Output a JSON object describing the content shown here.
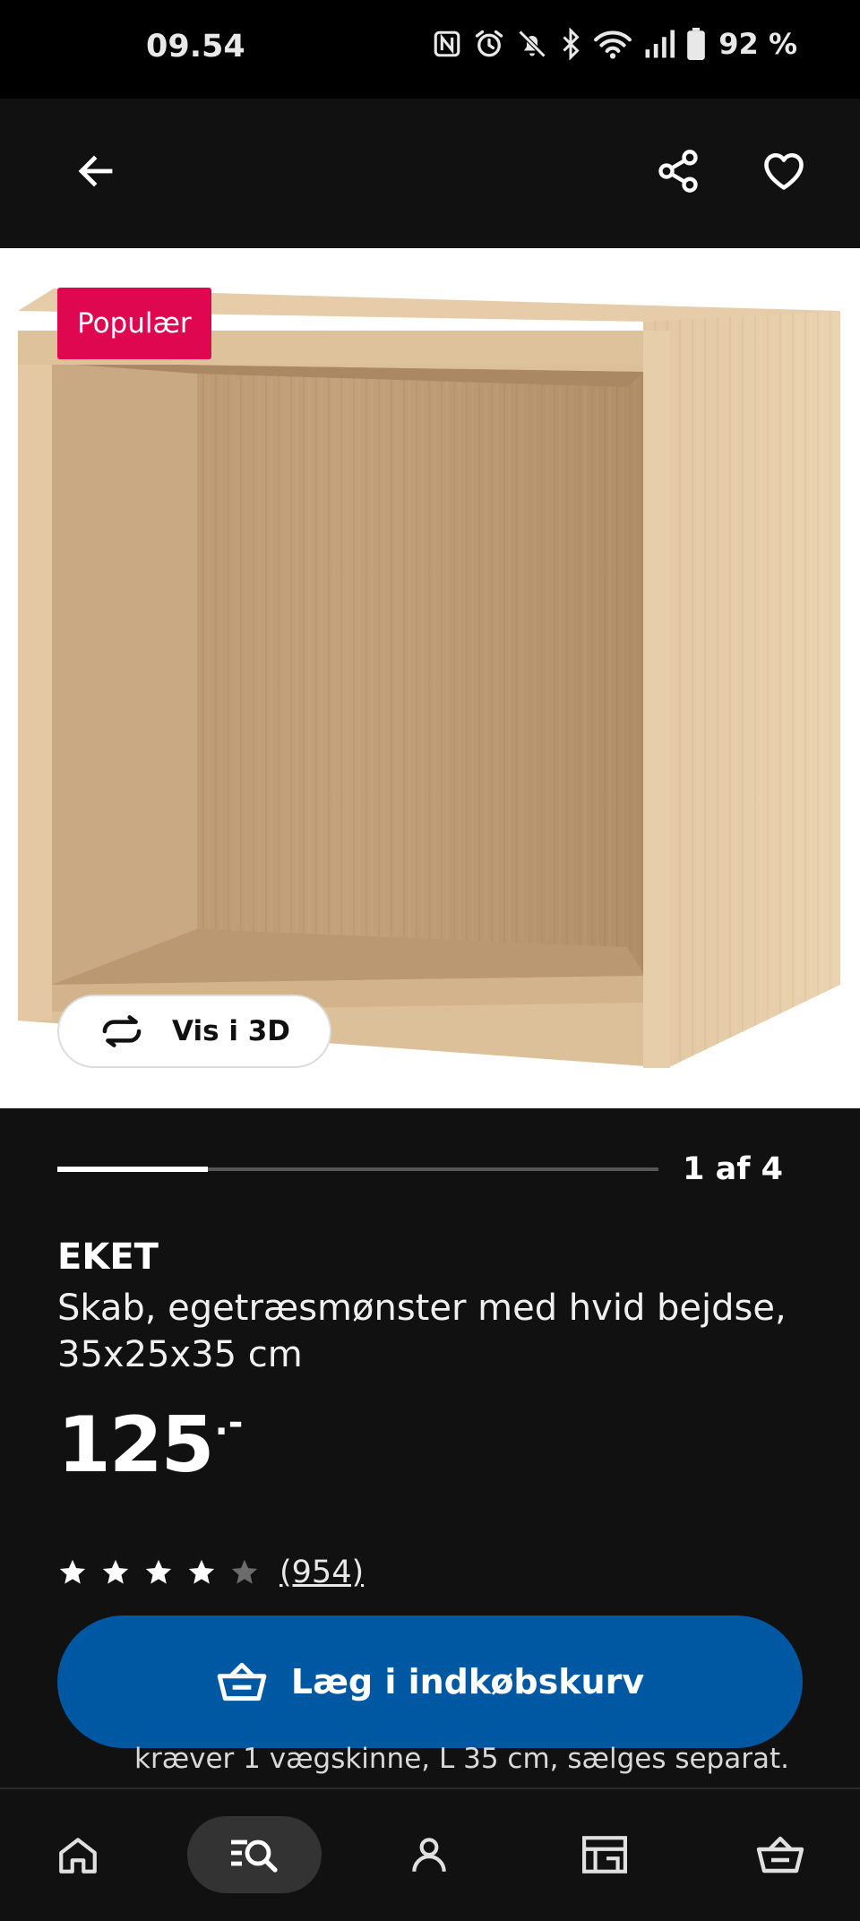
{
  "status_bar": {
    "time": "09.54",
    "battery": "92 %"
  },
  "product": {
    "badge": "Populær",
    "view_3d_label": "Vis i 3D",
    "gallery_counter": "1 af 4",
    "gallery_current": 1,
    "gallery_total": 4,
    "name": "EKET",
    "description": "Skab, egetræsmønster med hvid bejdse, 35x25x35 cm",
    "price": "125",
    "price_suffix": ".-",
    "rating": 4,
    "rating_max": 5,
    "review_count": "(954)"
  },
  "cart": {
    "label": "Læg i indkøbskurv"
  },
  "note": "kræver 1 vægskinne, L 35 cm, sælges separat.",
  "nav": [
    {
      "name": "home",
      "icon": "home-icon"
    },
    {
      "name": "search",
      "icon": "search-list-icon"
    },
    {
      "name": "profile",
      "icon": "person-icon"
    },
    {
      "name": "stores",
      "icon": "store-icon"
    },
    {
      "name": "cart",
      "icon": "basket-icon"
    }
  ],
  "colors": {
    "badge": "#e00751",
    "primary_button": "#0058a3",
    "background": "#111111"
  }
}
